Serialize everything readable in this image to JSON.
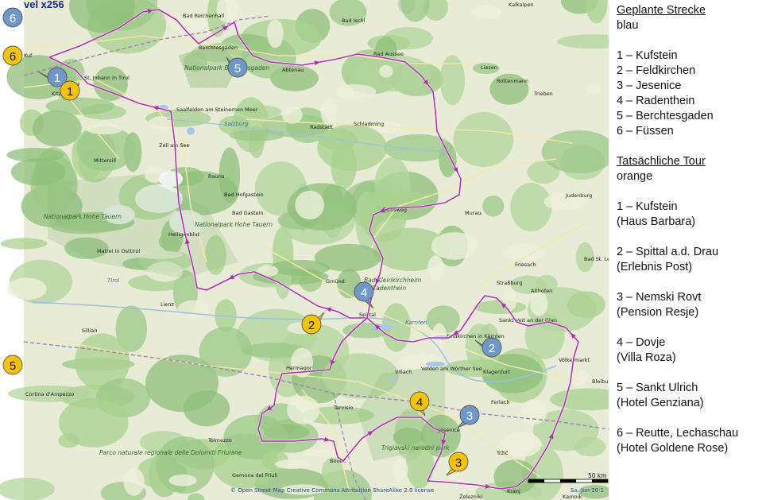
{
  "header": {
    "vel_label": "vel x256"
  },
  "legend": {
    "planned_title": "Geplante Strecke",
    "planned_color": "blau",
    "planned_items": [
      "1 – Kufstein",
      "2 – Feldkirchen",
      "3 – Jesenice",
      "4 – Radenthein",
      "5 – Berchtesgaden",
      "6 – Füssen"
    ],
    "actual_title": "Tatsächliche Tour",
    "actual_color": "orange",
    "actual_items": [
      {
        "line1": "1 – Kufstein",
        "line2": "(Haus Barbara)"
      },
      {
        "line1": "2 – Spittal a.d. Drau",
        "line2": "(Erlebnis Post)"
      },
      {
        "line1": "3 – Nemski Rovt",
        "line2": "(Pension Resje)"
      },
      {
        "line1": "4 – Dovje",
        "line2": "(Villa Roza)"
      },
      {
        "line1": "5 – Sankt Ulrich",
        "line2": "(Hotel Genziana)"
      },
      {
        "line1": "6 – Reutte, Lechaschau",
        "line2": "(Hotel Goldene Rose)"
      }
    ]
  },
  "markers": {
    "blue": [
      "1",
      "2",
      "3",
      "4",
      "5",
      "6"
    ],
    "orange": [
      "1",
      "2",
      "3",
      "4",
      "5",
      "6"
    ],
    "blue_color": "#6f98c9",
    "orange_color": "#f5c400"
  },
  "map": {
    "route_color": "#b030b0",
    "labels": {
      "bad_reichenhall": "Bad Reichenhall",
      "bad_ischl": "Bad Ischl",
      "berchtesgaden": "Berchtesgaden",
      "np_berchtesgaden": "Nationalpark Berchtesgaden",
      "abtenau": "Abtenau",
      "bad_aussee": "Bad Aussee",
      "liezen": "Liezen",
      "rottenmann": "Rottenmann",
      "trieben": "Trieben",
      "kalkalpen": "Kalkalpen",
      "st_johann": "St. Johann in Tirol",
      "kitzbuehel": "Kitzbühel",
      "kufstein_abbr": "Kuf",
      "saalfelden": "Saalfelden am Steinernen Meer",
      "salzburg": "Salzburg",
      "radstadt": "Radstadt",
      "schladming": "Schladming",
      "zell_am_see": "Zell am See",
      "mittersill": "Mittersill",
      "rauris": "Rauris",
      "bad_hofgastein": "Bad Hofgastein",
      "bad_gastein": "Bad Gastein",
      "tamsweg": "Tamsweg",
      "murau": "Murau",
      "judenburg": "Judenburg",
      "np_hohe_tauern_west": "Nationalpark Hohe Tauern",
      "np_hohe_tauern": "Nationalpark Hohe Tauern",
      "heiligenblut": "Heiligenblut",
      "matrei": "Matrei in Osttirol",
      "tirol": "Tirol",
      "bad_st_leonhard": "Bad St. Leonhard",
      "friesach": "Friesach",
      "gmuend": "Gmünd",
      "bad_kleinkirchheim": "Bad Kleinkirchheim",
      "strassburg": "Straßburg",
      "althofen": "Althofen",
      "radenthein": "Radenthein",
      "spittal": "Spittal",
      "lienz": "Lienz",
      "kaernten": "Kärnten",
      "sankt_veit": "Sankt Veit an der Glan",
      "feldkirchen": "Feldkirchen in Kärnten",
      "sillian": "Sillian",
      "voelkermarkt": "Völkermarkt",
      "hermagor": "Hermagor",
      "villach": "Villach",
      "velden": "Velden am Wörther See",
      "klagenfurt": "Klagenfurt",
      "bleiburg": "Bleiburg",
      "cortina": "Cortina d'Ampezzo",
      "tarvisio": "Tarvisio",
      "ferlach": "Ferlach",
      "tolmezzo": "Tolmezzo",
      "jesenice": "Jesenice",
      "triglav": "Triglavski narodni park",
      "trzic": "Tržič",
      "bovec": "Bovec",
      "parco": "Parco naturale regionale delle Dolomiti Friulane",
      "gemona": "Gemona del Friuli",
      "zelezniki": "Železniki",
      "kranj": "Kranj",
      "kamnik": "Kamnik"
    },
    "scale_label": "50 km",
    "attribution": "© Open Street Map  Creative Commons Attribution ShareAlike 2.0 license",
    "date": "Sa. Jun 20 1"
  }
}
